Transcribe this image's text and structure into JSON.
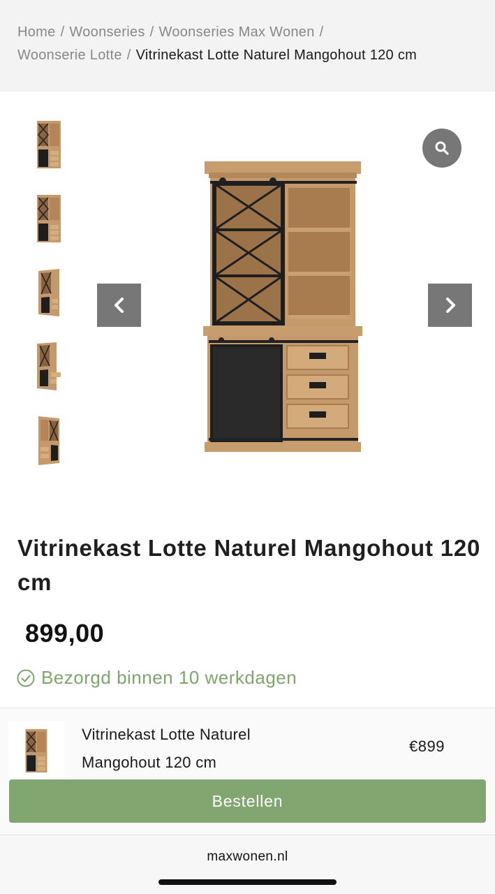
{
  "breadcrumb": {
    "items": [
      "Home",
      "Woonseries",
      "Woonseries Max Wonen",
      "Woonserie Lotte"
    ],
    "current": "Vitrinekast Lotte Naturel Mangohout 120 cm"
  },
  "gallery": {
    "thumbnails": [
      "cabinet-front",
      "cabinet-front",
      "cabinet-angle-left",
      "cabinet-angle-open-drawer",
      "cabinet-angle-right"
    ],
    "zoom_icon": "magnifier-icon",
    "prev_icon": "chevron-left-icon",
    "next_icon": "chevron-right-icon"
  },
  "product": {
    "title": "Vitrinekast Lotte Naturel Mangohout 120 cm",
    "price": "899,00",
    "delivery": "Bezorgd binnen 10 werkdagen"
  },
  "sticky_bar": {
    "name_line1": "Vitrinekast Lotte Naturel",
    "name_line2": "Mangohout 120 cm",
    "price": "€899",
    "order_label": "Bestellen"
  },
  "browser": {
    "url": "maxwonen.nl"
  },
  "colors": {
    "accent_green": "#82a66f",
    "delivery_green": "#7ea66b",
    "gray_button": "#777777",
    "wood": "#c49a6c",
    "metal": "#1e1e1e"
  }
}
